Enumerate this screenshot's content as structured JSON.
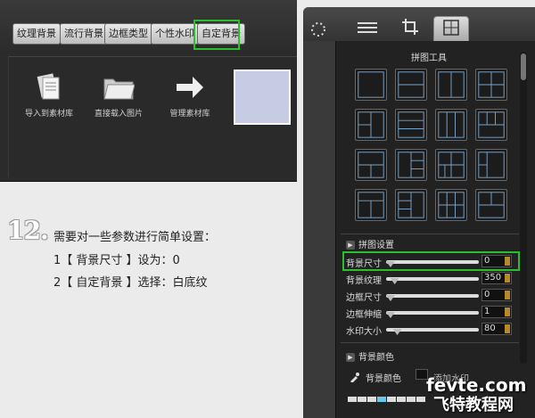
{
  "left_tabs": [
    "纹理背景",
    "流行背景",
    "边框类型",
    "个性水印",
    "自定背景"
  ],
  "tools": [
    {
      "label": "导入到素材库",
      "icon": "documents-icon"
    },
    {
      "label": "直接载入图片",
      "icon": "folder-icon"
    },
    {
      "label": "管理素材库",
      "icon": "arrow-right-icon"
    }
  ],
  "step": {
    "number": "12.",
    "line1": "需要对一些参数进行简单设置：",
    "line2": "1【 背景尺寸 】设为：0",
    "line3": "2【 自定背景 】选择：白底纹"
  },
  "panel": {
    "title": "拼图工具",
    "section_settings": "拼图设置",
    "sliders": [
      {
        "label": "背景尺寸",
        "value": "0",
        "level": 0.0
      },
      {
        "label": "背景纹理",
        "value": "350",
        "level": 0.05
      },
      {
        "label": "边框尺寸",
        "value": "0",
        "level": 0.0
      },
      {
        "label": "边框伸缩",
        "value": "1",
        "level": 0.0
      },
      {
        "label": "水印大小",
        "value": "80",
        "level": 0.08
      }
    ],
    "section_color": "背景颜色",
    "color_label": "背景颜色",
    "watermark_label": "添加水印"
  },
  "watermark": {
    "line1": "fevte.com",
    "line2": "飞特教程网"
  },
  "colors": {
    "highlight": "#2bbf2b",
    "preview": "#c7cbe3"
  }
}
